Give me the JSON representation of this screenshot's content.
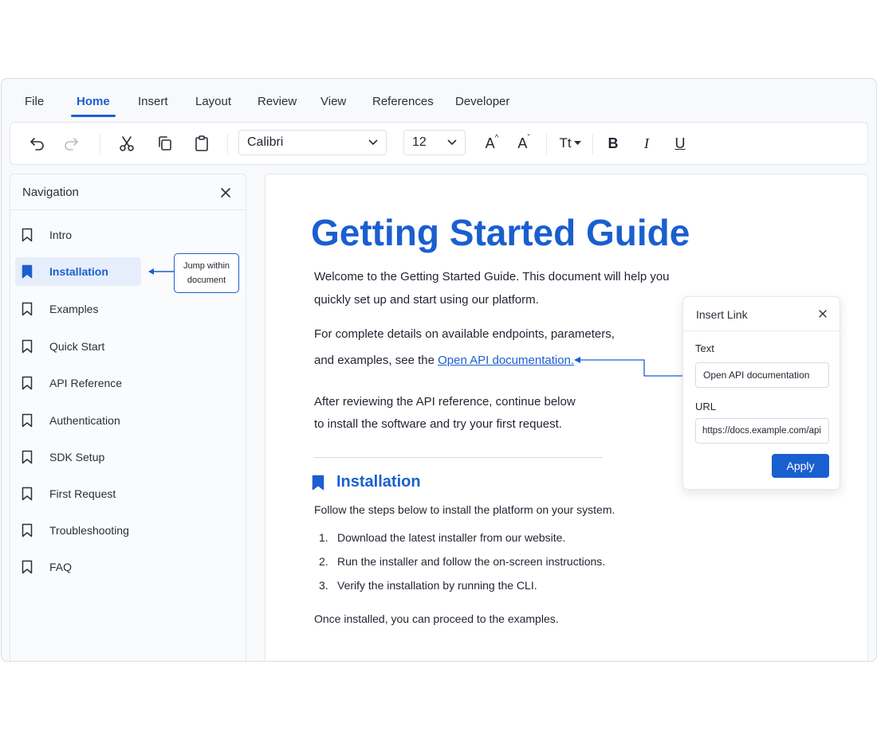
{
  "menu": {
    "tabs": [
      "File",
      "Home",
      "Insert",
      "Layout",
      "Review",
      "View",
      "References",
      "Developer"
    ],
    "active_tab": "Home"
  },
  "toolbar": {
    "font": "Calibri",
    "font_size": "12",
    "icons": [
      "undo-icon",
      "redo-icon",
      "cut-icon",
      "copy-icon",
      "paste-icon",
      "increase-font-icon",
      "decrease-font-icon",
      "text-case-icon",
      "bold-icon",
      "italic-icon",
      "underline-icon"
    ],
    "grow_label": "A",
    "shrink_label": "A",
    "case_label": "Tt",
    "bold_label": "B",
    "italic_label": "I",
    "underline_label": "U"
  },
  "navigation": {
    "title": "Navigation",
    "items": [
      "Intro",
      "Installation",
      "Examples",
      "Quick Start",
      "API Reference",
      "Authentication",
      "SDK Setup",
      "First Request",
      "Troubleshooting",
      "FAQ"
    ],
    "active_item": "Installation",
    "callout_line1": "Jump within",
    "callout_line2": "document"
  },
  "document": {
    "title": "Getting Started Guide",
    "intro_line1": "Welcome to the Getting Started Guide. This document will help you",
    "intro_line2": "quickly set up and start using our platform.",
    "details_line1": "For complete details on available endpoints, parameters,",
    "details_line2_prefix": "and examples, see the ",
    "details_link": "Open API documentation.",
    "after_line1": "After reviewing the API reference, continue below",
    "after_line2": "to install the software and try your first request.",
    "section_title": "Installation",
    "section_intro": "Follow the steps below to install the platform on your system.",
    "steps": [
      {
        "num": "1.",
        "text": "Download the latest installer from our website."
      },
      {
        "num": "2.",
        "text": "Run the installer and follow the on-screen instructions."
      },
      {
        "num": "3.",
        "text": "Verify the installation by running the CLI."
      }
    ],
    "closing": "Once installed, you can proceed to the examples."
  },
  "insert_link": {
    "title": "Insert Link",
    "text_label": "Text",
    "text_value": "Open API documentation",
    "url_label": "URL",
    "url_value": "https://docs.example.com/api",
    "apply_label": "Apply"
  },
  "colors": {
    "accent": "#1a5fd0",
    "border": "#e3e7ee"
  }
}
